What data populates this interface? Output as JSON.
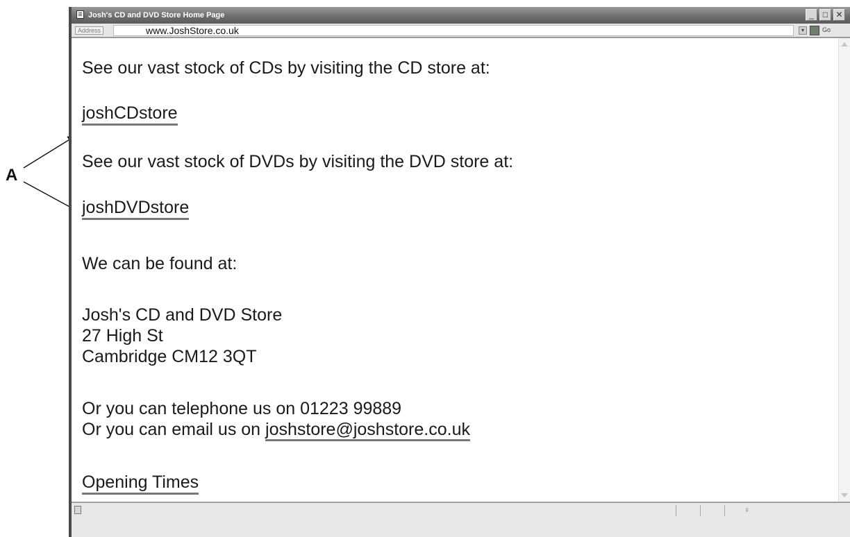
{
  "annotation": {
    "label": "A"
  },
  "window": {
    "title": "Josh's CD and DVD Store Home Page",
    "minimize_label": "_",
    "maximize_label": "□",
    "close_label": "✕"
  },
  "address_bar": {
    "label": "Address",
    "url": "www.JoshStore.co.uk",
    "go_label": "Go"
  },
  "content": {
    "cd_intro": "See our vast stock of CDs by visiting the CD store at:",
    "cd_link": "joshCDstore",
    "dvd_intro": "See our vast stock of DVDs by visiting the DVD store at:",
    "dvd_link": "joshDVDstore",
    "found_at": "We can be found at:",
    "address_lines": [
      "Josh's CD and DVD Store",
      "27 High St",
      "Cambridge CM12 3QT"
    ],
    "telephone": "Or you can telephone us on 01223 99889",
    "email_prefix": "Or you can email us on ",
    "email_link": "joshstore@joshstore.co.uk",
    "opening_times_link": "Opening Times"
  }
}
